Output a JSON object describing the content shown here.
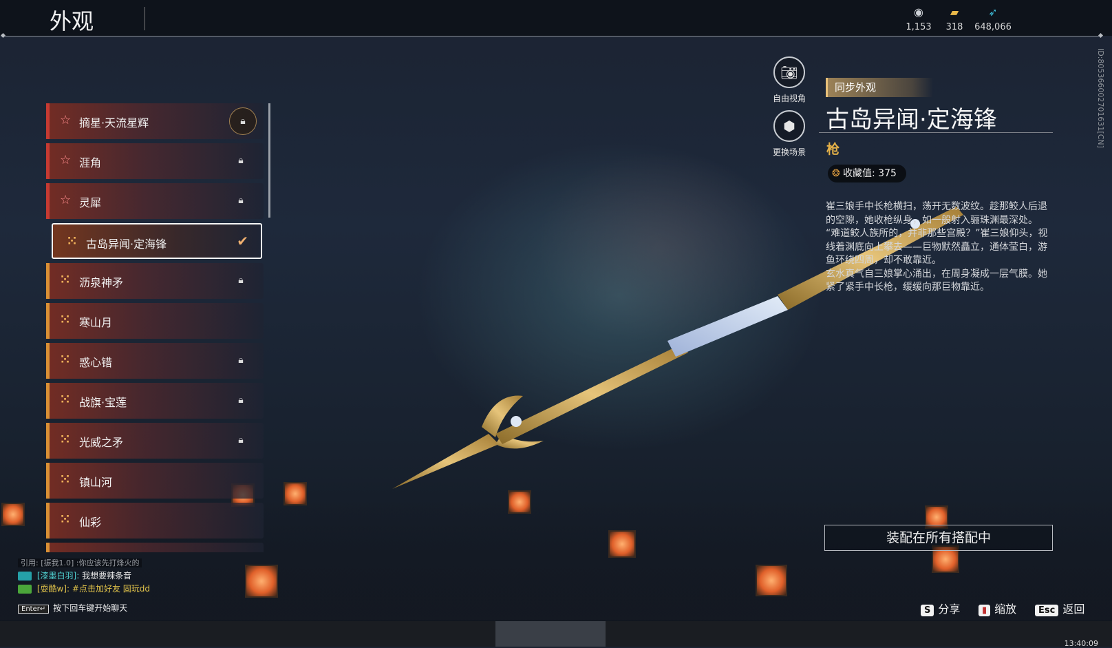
{
  "header": {
    "title": "外观",
    "currencies": [
      {
        "icon": "silver-coin-icon",
        "value": "1,153"
      },
      {
        "icon": "gold-ticket-icon",
        "value": "318"
      },
      {
        "icon": "feather-icon",
        "value": "648,066"
      }
    ]
  },
  "appearance_list": [
    {
      "name": "摘星·天流星辉",
      "tier": "red",
      "locked": true,
      "selected": false
    },
    {
      "name": "涯角",
      "tier": "red",
      "locked": true,
      "selected": false
    },
    {
      "name": "灵犀",
      "tier": "red",
      "locked": true,
      "selected": false
    },
    {
      "name": "古岛异闻·定海锋",
      "tier": "gold",
      "locked": false,
      "selected": true
    },
    {
      "name": "沥泉神矛",
      "tier": "gold",
      "locked": true,
      "selected": false
    },
    {
      "name": "寒山月",
      "tier": "gold",
      "locked": false,
      "selected": false
    },
    {
      "name": "惑心错",
      "tier": "gold",
      "locked": true,
      "selected": false
    },
    {
      "name": "战旗·宝莲",
      "tier": "gold",
      "locked": true,
      "selected": false
    },
    {
      "name": "光威之矛",
      "tier": "gold",
      "locked": true,
      "selected": false
    },
    {
      "name": "镇山河",
      "tier": "gold",
      "locked": false,
      "selected": false
    },
    {
      "name": "仙彩",
      "tier": "gold",
      "locked": false,
      "selected": false
    }
  ],
  "side_buttons": {
    "free_camera": "自由视角",
    "change_scene": "更换场景"
  },
  "detail": {
    "sync_tag": "同步外观",
    "title": "古岛异闻·定海锋",
    "type": "枪",
    "collection_label": "收藏值:",
    "collection_value": "375",
    "description": [
      "崔三娘手中长枪横扫，荡开无数波纹。趁那鲛人后退的空隙，她收枪纵身，如一般射入骊珠渊最深处。",
      "“难道鲛人族所的，并非那些宫殿？”崔三娘仰头，视线着渊底向上攀去——巨物默然矗立，通体莹白，游鱼环绕四周，却不敢靠近。",
      "玄水真气自三娘掌心涌出，在周身凝成一层气膜。她紧了紧手中长枪，缓缓向那巨物靠近。"
    ],
    "equip_button": "装配在所有搭配中"
  },
  "hints": {
    "share_key": "S",
    "share_label": "分享",
    "zoom_label": "缩放",
    "back_key": "Esc",
    "back_label": "返回"
  },
  "chat": {
    "quote": "引用: [振我1.0] :你应该先打烽火的",
    "line1_user": "[漆墨白羽]:",
    "line1_text": "我想要辣条音",
    "line2_user": "[耍酷w]:",
    "line2_text": "#点击加好友 固玩dd",
    "enter_key": "Enter↵",
    "enter_hint": "按下回车键开始聊天"
  },
  "side_id": "ID:805366002701631[CN]",
  "taskbar": {
    "time": "13:40:09"
  },
  "colors": {
    "accent_gold": "#e3b048",
    "tier_red": "#c63a32",
    "tier_gold": "#d99035"
  }
}
